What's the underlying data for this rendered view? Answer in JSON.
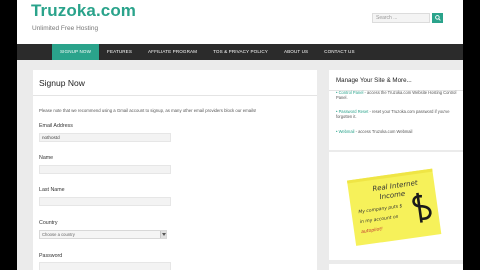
{
  "header": {
    "site_title": "Truzoka.com",
    "tagline": "Unlimited Free Hosting",
    "search_placeholder": "Search ..."
  },
  "nav": {
    "items": [
      {
        "label": "SIGNUP NOW",
        "active": true
      },
      {
        "label": "FEATURES"
      },
      {
        "label": "AFFILIATE PROGRAM"
      },
      {
        "label": "TOS & PRIVACY POLICY"
      },
      {
        "label": "ABOUT US"
      },
      {
        "label": "CONTACT US"
      }
    ]
  },
  "signup": {
    "title": "Signup Now",
    "notice": "Please note that we recommend using a Gmail account to signup, as many other email providers block our emails!",
    "email_label": "Email Address",
    "email_value": "nothostd",
    "name_label": "Name",
    "lastname_label": "Last Name",
    "country_label": "Country",
    "country_value": "Choose a country",
    "password_label": "Password"
  },
  "sidebar": {
    "title": "Manage Your Site & More...",
    "links": [
      {
        "link": "Control Panel",
        "text": " - access the Truzoka.com Website Hosting Control Panel."
      },
      {
        "link": "Password Reset",
        "text": " - reset your Truzoka.com password if you've forgotten it."
      },
      {
        "link": "Webmail",
        "text": " - access Truzoka.com Webmail"
      }
    ]
  },
  "banner": {
    "line1": "Real Internet",
    "line2": "Income",
    "line3": "My company puts $",
    "line4": "in my account on",
    "line5": "autopilot!"
  },
  "colors": {
    "accent": "#2aa38b",
    "nav_bg": "#2b2b2b",
    "page_bg": "#ebebeb",
    "note_yellow": "#f6f15a"
  }
}
